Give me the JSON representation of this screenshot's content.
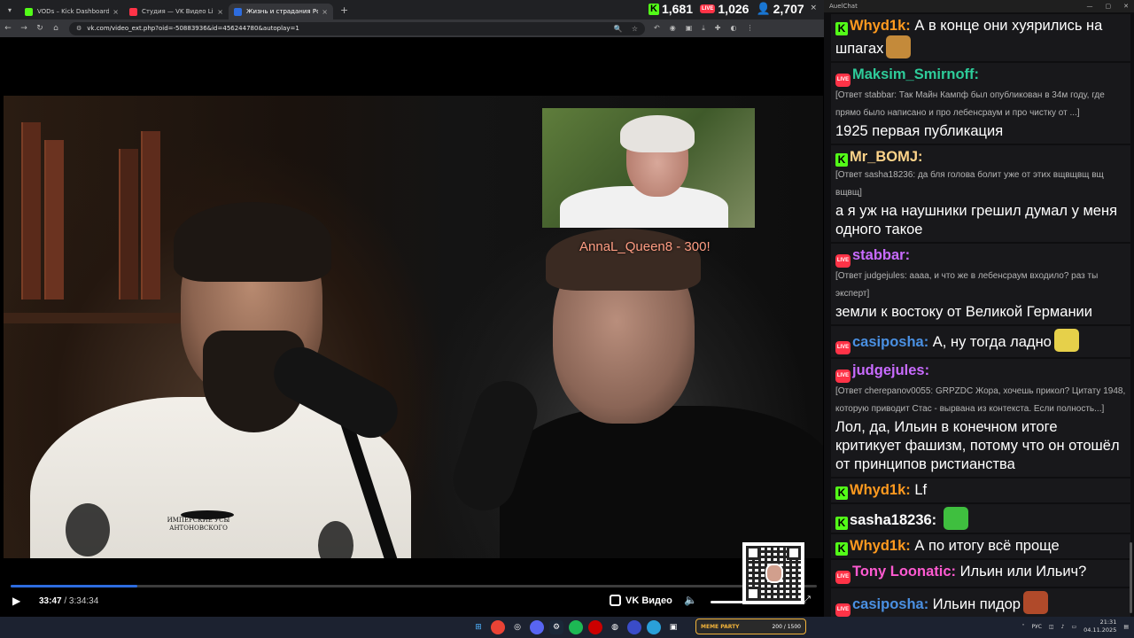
{
  "browser": {
    "tabs": [
      {
        "label": "VODs – Kick Dashboard",
        "color": "#53fc18",
        "active": false
      },
      {
        "label": "Студия — VK Видео Live",
        "color": "#ff3347",
        "active": false
      },
      {
        "label": "Жизнь и страдания Романа А",
        "color": "#2d6cdf",
        "active": true
      }
    ],
    "url": "vk.com/video_ext.php?oid=-50883936&id=456244780&autoplay=1",
    "close_glyph": "×",
    "newtab_glyph": "+"
  },
  "stats": {
    "kick": "1,681",
    "vk": "1,026",
    "twitch": "2,707",
    "vk_live_label": "LIVE"
  },
  "video": {
    "overlay_text": "AnnaL_Queen8 - 300!",
    "shirt_text": "ИМПЕРСКИЕ УСЫ АНТОНОВСКОГО"
  },
  "player": {
    "current_time": "33:47",
    "total_time": "3:34:34",
    "progress": 0.157,
    "brand": "VK Видео"
  },
  "chat": {
    "window_title": "AuelChat",
    "messages": [
      {
        "platform": "kick",
        "user": "Whyd1k:",
        "user_color": "#ff9a1f",
        "reply": "",
        "text": "А в конце они хуярились на шпагах",
        "emote": "#c48a3a"
      },
      {
        "platform": "vk",
        "user": "Maksim_Smirnoff:",
        "user_color": "#2ecc9a",
        "reply": "[Ответ stabbar: Так Майн Кампф был опубликован в 34м году, где прямо было написано и про лебенсраум и про чистку от ...]",
        "text": "1925 первая публикация",
        "emote": ""
      },
      {
        "platform": "kick",
        "user": "Mr_BOMJ:",
        "user_color": "#ffd48a",
        "reply": "[Ответ sasha18236: да бля голова болит уже от этих вщвщвщ вщ вщвщ]",
        "text": "а я уж на наушники грешил думал у меня одного такое",
        "emote": ""
      },
      {
        "platform": "vk",
        "user": "stabbar:",
        "user_color": "#c86bff",
        "reply": "[Ответ judgejules: аааа, и что же в лебенсраум входило? раз ты эксперт]",
        "text": "земли к востоку от Великой Германии",
        "emote": ""
      },
      {
        "platform": "vk",
        "user": "casiposha:",
        "user_color": "#4a90e2",
        "reply": "",
        "text": "А, ну тогда ладно",
        "emote": "#e6d04a"
      },
      {
        "platform": "vk",
        "user": "judgejules:",
        "user_color": "#c86bff",
        "reply": "[Ответ cherepanov0055: GRPZDC Жора, хочешь прикол? Цитату 1948, которую приводит Стас - вырвана из контекста. Если полность...]",
        "text": "Лол, да, Ильин в конечном итоге критикует фашизм, потому что он отошёл от принципов ристианства",
        "emote": ""
      },
      {
        "platform": "kick",
        "user": "Whyd1k:",
        "user_color": "#ff9a1f",
        "reply": "",
        "text": "Lf",
        "emote": ""
      },
      {
        "platform": "kick",
        "user": "sasha18236:",
        "user_color": "#ffffff",
        "reply": "",
        "text": "",
        "emote": "#3fbf3f"
      },
      {
        "platform": "kick",
        "user": "Whyd1k:",
        "user_color": "#ff9a1f",
        "reply": "",
        "text": "А по итогу всё проще",
        "emote": ""
      },
      {
        "platform": "vk",
        "user": "Tony Loonatic:",
        "user_color": "#ff5ad1",
        "reply": "",
        "text": "Ильин или Ильич?",
        "emote": ""
      },
      {
        "platform": "vk",
        "user": "casiposha:",
        "user_color": "#4a90e2",
        "reply": "",
        "text": "Ильин пидор",
        "emote": "#b04a2a"
      }
    ]
  },
  "taskbar": {
    "widget_title": "MEME PARTY",
    "widget_value": "200 / 1500",
    "lang": "РУС",
    "time": "21:31",
    "date": "04.11.2025"
  }
}
